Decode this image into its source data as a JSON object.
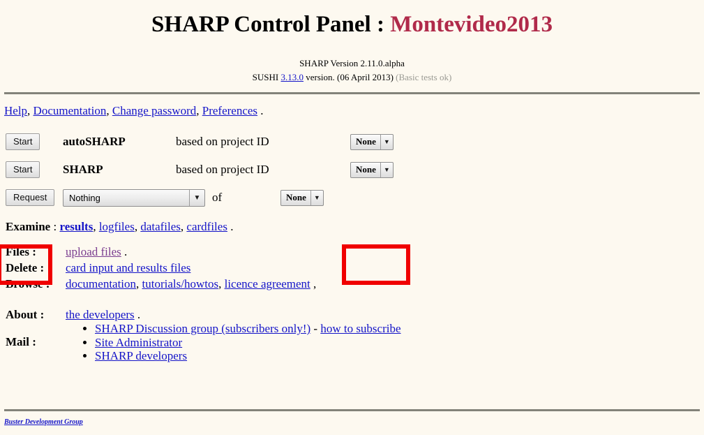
{
  "header": {
    "title_main": "SHARP Control Panel : ",
    "title_accent": "Montevideo2013",
    "version_line": "SHARP Version 2.11.0.alpha",
    "sushi_prefix": "SUSHI ",
    "sushi_version_link": "3.13.0",
    "sushi_suffix": " version. (06 April 2013)",
    "sushi_status": "(Basic tests ok)"
  },
  "nav": {
    "links": [
      {
        "label": "Help"
      },
      {
        "label": "Documentation"
      },
      {
        "label": "Change password"
      },
      {
        "label": "Preferences"
      }
    ],
    "separator": ", ",
    "terminator": " ."
  },
  "rows": [
    {
      "button": "Start",
      "name": "autoSHARP",
      "description": "based on project ID",
      "select_value": "None"
    },
    {
      "button": "Start",
      "name": "SHARP",
      "description": "based on project ID",
      "select_value": "None"
    }
  ],
  "request_row": {
    "button": "Request",
    "select_value": "Nothing",
    "of_word": "of",
    "target_select_value": "None"
  },
  "examine": {
    "label": "Examine",
    "colon": " : ",
    "links": [
      {
        "label": "results",
        "bold": true
      },
      {
        "label": "logfiles",
        "bold": false
      },
      {
        "label": "datafiles",
        "bold": false
      },
      {
        "label": "cardfiles",
        "bold": false
      }
    ],
    "terminator": " ."
  },
  "sections": {
    "files_label": "Files :",
    "files_link": "upload files",
    "files_terminator": " .",
    "delete_label": "Delete :",
    "delete_link": "card input and results files",
    "browse_label": "Browse :",
    "browse_link_1": "documentation",
    "browse_link_2": "tutorials/howtos",
    "browse_link_3": "licence agreement",
    "browse_terminator": " ,",
    "about_label": "About :",
    "about_link": "the developers",
    "about_terminator": " .",
    "mail_label": "Mail :",
    "mail_items": [
      {
        "link": "SHARP Discussion group (subscribers only!)",
        "mid": " - ",
        "link2": "how to subscribe"
      },
      {
        "link": "Site Administrator"
      },
      {
        "link": "SHARP developers"
      }
    ]
  },
  "footer": {
    "link": "Buster Development Group"
  },
  "colors": {
    "background": "#fdf9f0",
    "link": "#1414c8",
    "visited_link": "#7a3d8f",
    "accent_title": "#b02a4a",
    "rule": "#83837a",
    "highlight": "#f00000",
    "muted_text": "#9a9a93"
  }
}
